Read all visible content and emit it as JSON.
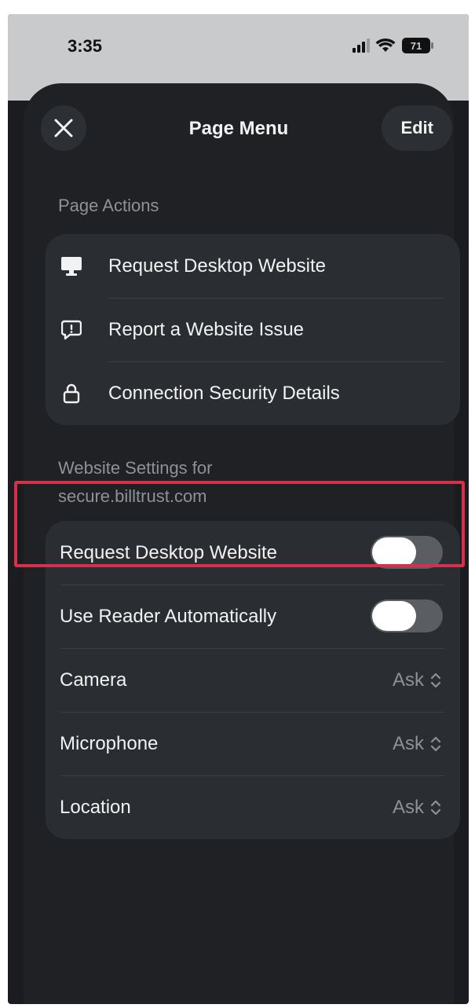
{
  "status_bar": {
    "time": "3:35",
    "battery": "71"
  },
  "sheet": {
    "title": "Page Menu",
    "edit_label": "Edit"
  },
  "page_actions": {
    "header": "Page Actions",
    "items": [
      {
        "label": "Request Desktop Website",
        "icon": "desktop-icon"
      },
      {
        "label": "Report a Website Issue",
        "icon": "report-bubble-icon"
      },
      {
        "label": "Connection Security Details",
        "icon": "lock-icon"
      }
    ]
  },
  "website_settings": {
    "header_line1": "Website Settings for",
    "header_line2": "secure.billtrust.com",
    "request_desktop": {
      "label": "Request Desktop Website",
      "on": false
    },
    "reader": {
      "label": "Use Reader Automatically",
      "on": false
    },
    "camera": {
      "label": "Camera",
      "value": "Ask"
    },
    "microphone": {
      "label": "Microphone",
      "value": "Ask"
    },
    "location": {
      "label": "Location",
      "value": "Ask"
    }
  },
  "colors": {
    "highlight": "#d6304a",
    "sheet_bg": "#1f2125",
    "group_bg": "#2a2d31"
  }
}
